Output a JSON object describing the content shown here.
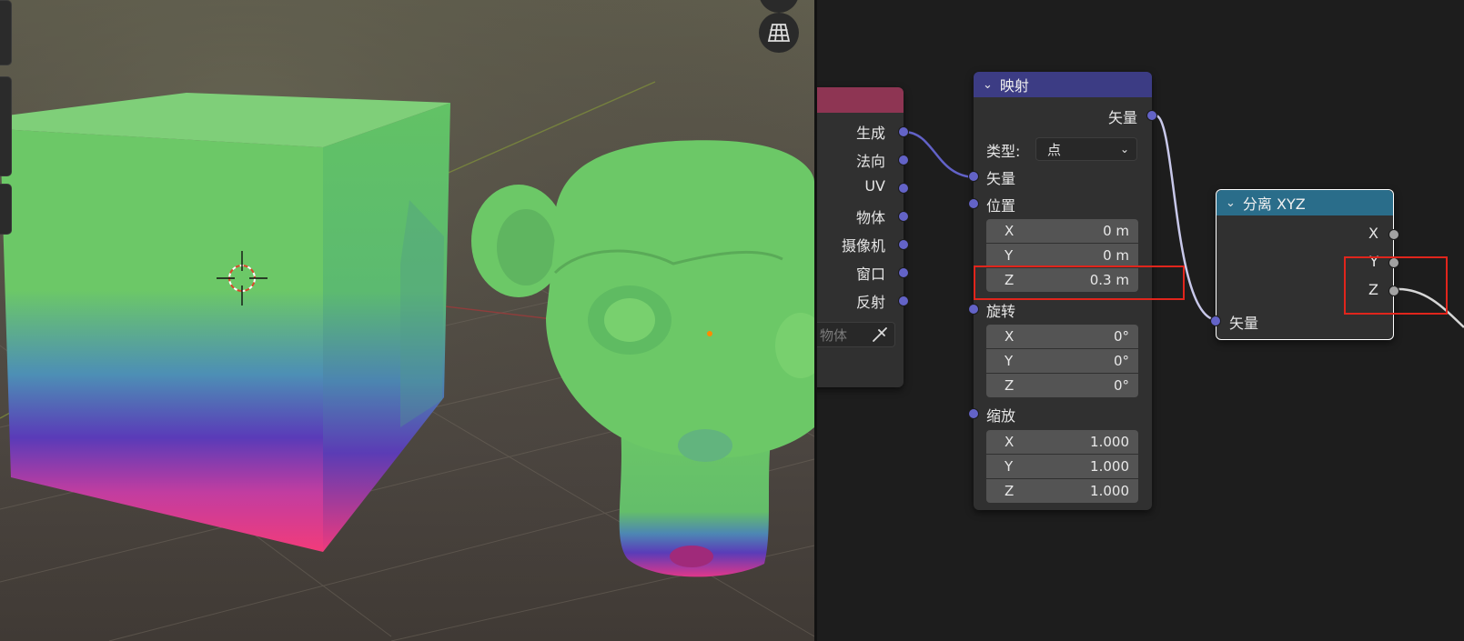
{
  "viewport": {
    "gizmo_icon": "grid-perspective-icon"
  },
  "texcoord_node": {
    "outputs": [
      "生成",
      "法向",
      "UV",
      "物体",
      "摄像机",
      "窗口",
      "反射"
    ],
    "object_placeholder": "物体",
    "eyedropper_icon": "eyedropper-icon",
    "header_color": "#8e3553"
  },
  "mapping_node": {
    "title": "映射",
    "header_color": "#3c3c84",
    "output_vector": "矢量",
    "type_label": "类型:",
    "type_value": "点",
    "input_vector": "矢量",
    "location_label": "位置",
    "location": [
      {
        "axis": "X",
        "value": "0 m"
      },
      {
        "axis": "Y",
        "value": "0 m"
      },
      {
        "axis": "Z",
        "value": "0.3 m"
      }
    ],
    "rotation_label": "旋转",
    "rotation": [
      {
        "axis": "X",
        "value": "0°"
      },
      {
        "axis": "Y",
        "value": "0°"
      },
      {
        "axis": "Z",
        "value": "0°"
      }
    ],
    "scale_label": "缩放",
    "scale": [
      {
        "axis": "X",
        "value": "1.000"
      },
      {
        "axis": "Y",
        "value": "1.000"
      },
      {
        "axis": "Z",
        "value": "1.000"
      }
    ]
  },
  "separate_node": {
    "title": "分离 XYZ",
    "header_color": "#2a6d8a",
    "outputs": [
      "X",
      "Y",
      "Z"
    ],
    "input": "矢量"
  },
  "colors": {
    "vector_socket": "#6363c7",
    "float_socket": "#a1a1a1",
    "highlight": "#e0251c"
  }
}
